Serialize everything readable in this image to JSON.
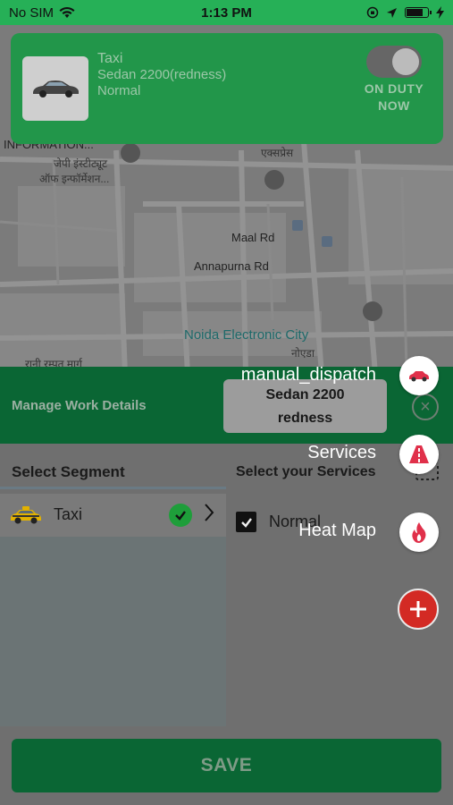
{
  "status_bar": {
    "carrier": "No SIM",
    "time": "1:13 PM",
    "battery_level": 0.8
  },
  "map": {
    "labels": {
      "info": "INFORMATION...",
      "hindi1": "जेपी इंस्टीट्यूट",
      "hindi2": "ऑफ इन्फॉर्मेशन...",
      "hindi3": "एक्सप्रेस",
      "maal_rd": "Maal Rd",
      "annapurna_rd": "Annapurna Rd",
      "noida_city": "Noida Electronic City",
      "noida_hindi": "नोएडा",
      "rani_marg": "रानी रम्पत मार्ग"
    }
  },
  "driver_card": {
    "vehicle_type": "Taxi",
    "vehicle_model": "Sedan 2200(redness)",
    "service": "Normal",
    "duty_label_line1": "ON DUTY",
    "duty_label_line2": "NOW",
    "on_duty": true
  },
  "manage_bar": {
    "title": "Manage Work Details",
    "vehicle_line1": "Sedan 2200",
    "vehicle_line2": "redness"
  },
  "segments": {
    "header": "Select Segment",
    "items": [
      {
        "label": "Taxi",
        "selected": true
      }
    ]
  },
  "services": {
    "header": "Select your Services",
    "items": [
      {
        "label": "Normal",
        "checked": true
      }
    ]
  },
  "save_button": {
    "label": "SAVE"
  },
  "fab_menu": {
    "items": [
      {
        "label": "manual_dispatch",
        "icon": "car-icon"
      },
      {
        "label": "Services",
        "icon": "road-icon"
      },
      {
        "label": "Heat Map",
        "icon": "flame-icon"
      }
    ],
    "main_icon": "plus-icon"
  },
  "colors": {
    "accent_green": "#26b057",
    "dark_green": "#0a6634",
    "fab_red": "#d32a24"
  }
}
